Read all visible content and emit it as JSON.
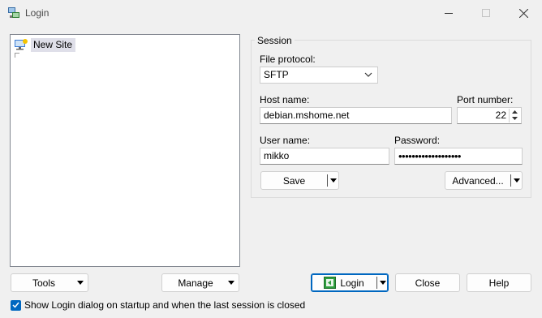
{
  "window": {
    "title": "Login"
  },
  "sites": {
    "items": [
      "New Site"
    ]
  },
  "session": {
    "group_title": "Session",
    "protocol_label": "File protocol:",
    "protocol_value": "SFTP",
    "host_label": "Host name:",
    "host_value": "debian.mshome.net",
    "port_label": "Port number:",
    "port_value": "22",
    "user_label": "User name:",
    "user_value": "mikko",
    "password_label": "Password:",
    "password_value": "•••••••••••••••••••",
    "save_label": "Save",
    "advanced_label": "Advanced..."
  },
  "footer": {
    "tools_label": "Tools",
    "manage_label": "Manage",
    "login_label": "Login",
    "close_label": "Close",
    "help_label": "Help",
    "startup_checkbox_label": "Show Login dialog on startup and when the last session is closed",
    "startup_checked": true
  },
  "colors": {
    "accent": "#0067c0",
    "selection": "#dfdfe9"
  }
}
